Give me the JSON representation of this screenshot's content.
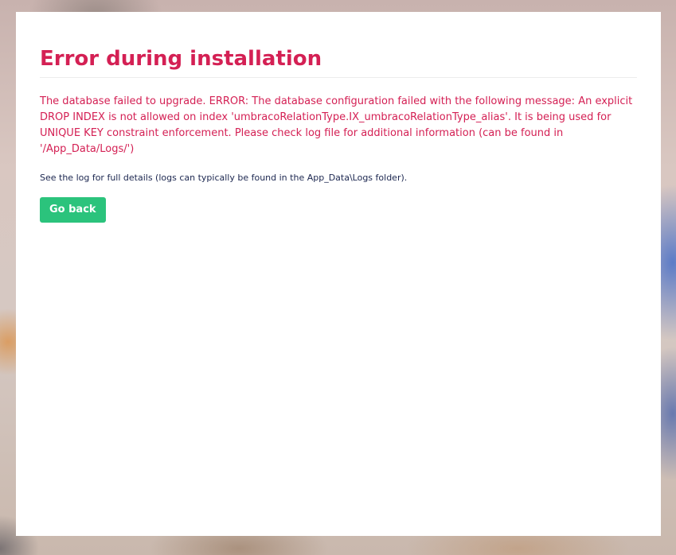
{
  "installer": {
    "title": "Error during installation",
    "error_message": "The database failed to upgrade. ERROR: The database configuration failed with the following message: An explicit DROP INDEX is not allowed on index 'umbracoRelationType.IX_umbracoRelationType_alias'. It is being used for UNIQUE KEY constraint enforcement. Please check log file for additional information (can be found in '/App_Data/Logs/')",
    "hint": "See the log for full details (logs can typically be found in the App_Data\\Logs folder).",
    "go_back_label": "Go back"
  },
  "colors": {
    "error_red": "#d42054",
    "button_green": "#2bc37c",
    "hint_text": "#1b264f"
  }
}
